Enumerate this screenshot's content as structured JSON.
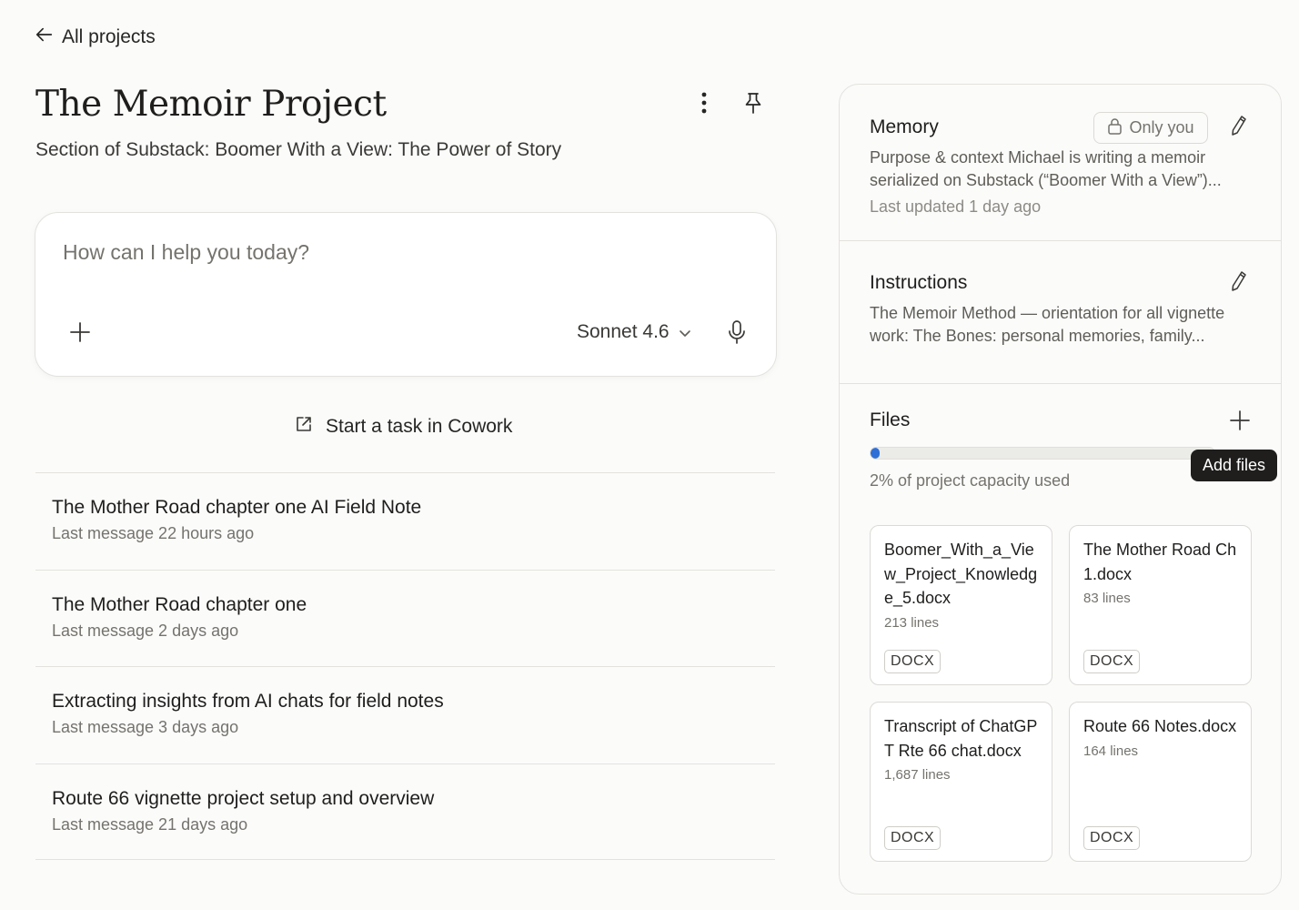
{
  "nav": {
    "back_label": "All projects"
  },
  "project": {
    "title": "The Memoir Project",
    "description": "Section of Substack: Boomer With a View: The Power of Story"
  },
  "composer": {
    "placeholder": "How can I help you today?",
    "model": "Sonnet 4.6"
  },
  "cowork": {
    "label": "Start a task in Cowork"
  },
  "chats": [
    {
      "title": "The Mother Road chapter one AI Field Note",
      "meta": "Last message 22 hours ago"
    },
    {
      "title": "The Mother Road chapter one",
      "meta": "Last message 2 days ago"
    },
    {
      "title": "Extracting insights from AI chats for field notes",
      "meta": "Last message 3 days ago"
    },
    {
      "title": "Route 66 vignette project setup and overview",
      "meta": "Last message 21 days ago"
    }
  ],
  "memory": {
    "heading": "Memory",
    "privacy": "Only you",
    "text": "Purpose & context Michael is writing a memoir serialized on Substack (“Boomer With a View”)...",
    "updated": "Last updated 1 day ago"
  },
  "instructions": {
    "heading": "Instructions",
    "text": "The Memoir Method — orientation for all vignette work: The Bones: personal memories, family..."
  },
  "files": {
    "heading": "Files",
    "capacity_percent": 2,
    "capacity_text": "2% of project capacity used",
    "tooltip": "Add files",
    "items": [
      {
        "name": "Boomer_With_a_View_Project_Knowledge_5.docx",
        "lines": "213 lines",
        "type": "DOCX"
      },
      {
        "name": "The Mother Road Ch 1.docx",
        "lines": "83 lines",
        "type": "DOCX"
      },
      {
        "name": "Transcript of ChatGPT Rte 66 chat.docx",
        "lines": "1,687 lines",
        "type": "DOCX"
      },
      {
        "name": "Route 66 Notes.docx",
        "lines": "164 lines",
        "type": "DOCX"
      }
    ]
  },
  "colors": {
    "accent_progress": "#2d6fd6",
    "tooltip_bg": "#1f1e1d"
  }
}
